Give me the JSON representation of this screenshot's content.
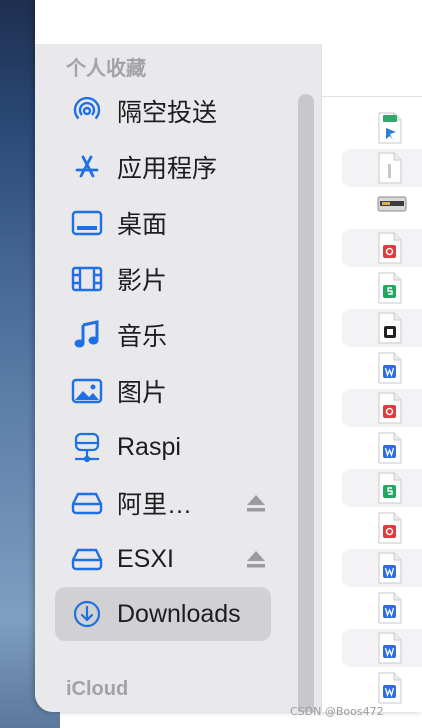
{
  "sidebar": {
    "favorites_header": "个人收藏",
    "items": [
      {
        "label": "隔空投送",
        "icon": "airdrop-icon"
      },
      {
        "label": "应用程序",
        "icon": "applications-icon"
      },
      {
        "label": "桌面",
        "icon": "desktop-icon"
      },
      {
        "label": "影片",
        "icon": "movies-icon"
      },
      {
        "label": "音乐",
        "icon": "music-icon"
      },
      {
        "label": "图片",
        "icon": "pictures-icon"
      },
      {
        "label": "Raspi",
        "icon": "network-server-icon"
      },
      {
        "label": "阿里…",
        "icon": "drive-icon",
        "ejectable": true
      },
      {
        "label": "ESXI",
        "icon": "drive-icon",
        "ejectable": true
      },
      {
        "label": "Downloads",
        "icon": "downloads-icon",
        "selected": true
      }
    ],
    "icloud_header": "iCloud"
  },
  "files": [
    {
      "type": "torrent",
      "icon": "torrent-file-icon"
    },
    {
      "type": "generic",
      "icon": "generic-file-icon"
    },
    {
      "type": "installer",
      "icon": "installer-file-icon"
    },
    {
      "type": "pdf",
      "icon": "pdf-file-icon"
    },
    {
      "type": "spreadsheet",
      "icon": "spreadsheet-file-icon"
    },
    {
      "type": "app",
      "icon": "app-file-icon"
    },
    {
      "type": "word",
      "icon": "word-file-icon"
    },
    {
      "type": "pdf",
      "icon": "pdf-file-icon"
    },
    {
      "type": "word",
      "icon": "word-file-icon"
    },
    {
      "type": "spreadsheet",
      "icon": "spreadsheet-file-icon"
    },
    {
      "type": "pdf",
      "icon": "pdf-file-icon"
    },
    {
      "type": "word",
      "icon": "word-file-icon"
    },
    {
      "type": "word",
      "icon": "word-file-icon"
    },
    {
      "type": "word",
      "icon": "word-file-icon"
    },
    {
      "type": "word",
      "icon": "word-file-icon"
    }
  ],
  "watermark": "CSDN @Boos472",
  "colors": {
    "accent": "#1f6fe5",
    "sidebar_bg": "#e9e9eb",
    "selected_bg": "#d1d1d4"
  }
}
